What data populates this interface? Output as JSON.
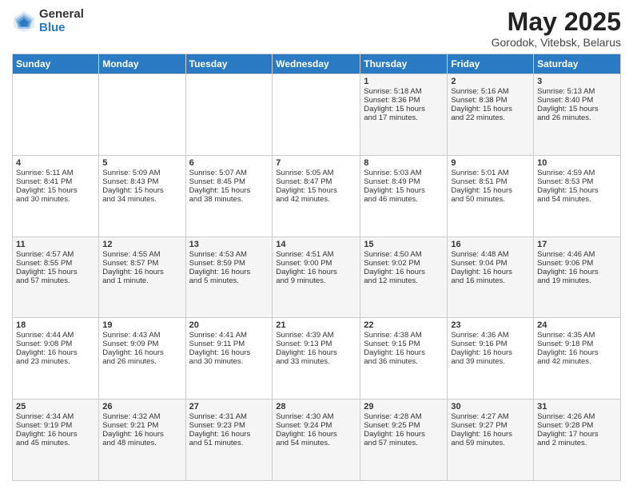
{
  "header": {
    "logo_general": "General",
    "logo_blue": "Blue",
    "month_title": "May 2025",
    "subtitle": "Gorodok, Vitebsk, Belarus"
  },
  "days_of_week": [
    "Sunday",
    "Monday",
    "Tuesday",
    "Wednesday",
    "Thursday",
    "Friday",
    "Saturday"
  ],
  "weeks": [
    [
      {
        "day": "",
        "info": ""
      },
      {
        "day": "",
        "info": ""
      },
      {
        "day": "",
        "info": ""
      },
      {
        "day": "",
        "info": ""
      },
      {
        "day": "1",
        "info": "Sunrise: 5:18 AM\nSunset: 8:36 PM\nDaylight: 15 hours\nand 17 minutes."
      },
      {
        "day": "2",
        "info": "Sunrise: 5:16 AM\nSunset: 8:38 PM\nDaylight: 15 hours\nand 22 minutes."
      },
      {
        "day": "3",
        "info": "Sunrise: 5:13 AM\nSunset: 8:40 PM\nDaylight: 15 hours\nand 26 minutes."
      }
    ],
    [
      {
        "day": "4",
        "info": "Sunrise: 5:11 AM\nSunset: 8:41 PM\nDaylight: 15 hours\nand 30 minutes."
      },
      {
        "day": "5",
        "info": "Sunrise: 5:09 AM\nSunset: 8:43 PM\nDaylight: 15 hours\nand 34 minutes."
      },
      {
        "day": "6",
        "info": "Sunrise: 5:07 AM\nSunset: 8:45 PM\nDaylight: 15 hours\nand 38 minutes."
      },
      {
        "day": "7",
        "info": "Sunrise: 5:05 AM\nSunset: 8:47 PM\nDaylight: 15 hours\nand 42 minutes."
      },
      {
        "day": "8",
        "info": "Sunrise: 5:03 AM\nSunset: 8:49 PM\nDaylight: 15 hours\nand 46 minutes."
      },
      {
        "day": "9",
        "info": "Sunrise: 5:01 AM\nSunset: 8:51 PM\nDaylight: 15 hours\nand 50 minutes."
      },
      {
        "day": "10",
        "info": "Sunrise: 4:59 AM\nSunset: 8:53 PM\nDaylight: 15 hours\nand 54 minutes."
      }
    ],
    [
      {
        "day": "11",
        "info": "Sunrise: 4:57 AM\nSunset: 8:55 PM\nDaylight: 15 hours\nand 57 minutes."
      },
      {
        "day": "12",
        "info": "Sunrise: 4:55 AM\nSunset: 8:57 PM\nDaylight: 16 hours\nand 1 minute."
      },
      {
        "day": "13",
        "info": "Sunrise: 4:53 AM\nSunset: 8:59 PM\nDaylight: 16 hours\nand 5 minutes."
      },
      {
        "day": "14",
        "info": "Sunrise: 4:51 AM\nSunset: 9:00 PM\nDaylight: 16 hours\nand 9 minutes."
      },
      {
        "day": "15",
        "info": "Sunrise: 4:50 AM\nSunset: 9:02 PM\nDaylight: 16 hours\nand 12 minutes."
      },
      {
        "day": "16",
        "info": "Sunrise: 4:48 AM\nSunset: 9:04 PM\nDaylight: 16 hours\nand 16 minutes."
      },
      {
        "day": "17",
        "info": "Sunrise: 4:46 AM\nSunset: 9:06 PM\nDaylight: 16 hours\nand 19 minutes."
      }
    ],
    [
      {
        "day": "18",
        "info": "Sunrise: 4:44 AM\nSunset: 9:08 PM\nDaylight: 16 hours\nand 23 minutes."
      },
      {
        "day": "19",
        "info": "Sunrise: 4:43 AM\nSunset: 9:09 PM\nDaylight: 16 hours\nand 26 minutes."
      },
      {
        "day": "20",
        "info": "Sunrise: 4:41 AM\nSunset: 9:11 PM\nDaylight: 16 hours\nand 30 minutes."
      },
      {
        "day": "21",
        "info": "Sunrise: 4:39 AM\nSunset: 9:13 PM\nDaylight: 16 hours\nand 33 minutes."
      },
      {
        "day": "22",
        "info": "Sunrise: 4:38 AM\nSunset: 9:15 PM\nDaylight: 16 hours\nand 36 minutes."
      },
      {
        "day": "23",
        "info": "Sunrise: 4:36 AM\nSunset: 9:16 PM\nDaylight: 16 hours\nand 39 minutes."
      },
      {
        "day": "24",
        "info": "Sunrise: 4:35 AM\nSunset: 9:18 PM\nDaylight: 16 hours\nand 42 minutes."
      }
    ],
    [
      {
        "day": "25",
        "info": "Sunrise: 4:34 AM\nSunset: 9:19 PM\nDaylight: 16 hours\nand 45 minutes."
      },
      {
        "day": "26",
        "info": "Sunrise: 4:32 AM\nSunset: 9:21 PM\nDaylight: 16 hours\nand 48 minutes."
      },
      {
        "day": "27",
        "info": "Sunrise: 4:31 AM\nSunset: 9:23 PM\nDaylight: 16 hours\nand 51 minutes."
      },
      {
        "day": "28",
        "info": "Sunrise: 4:30 AM\nSunset: 9:24 PM\nDaylight: 16 hours\nand 54 minutes."
      },
      {
        "day": "29",
        "info": "Sunrise: 4:28 AM\nSunset: 9:25 PM\nDaylight: 16 hours\nand 57 minutes."
      },
      {
        "day": "30",
        "info": "Sunrise: 4:27 AM\nSunset: 9:27 PM\nDaylight: 16 hours\nand 59 minutes."
      },
      {
        "day": "31",
        "info": "Sunrise: 4:26 AM\nSunset: 9:28 PM\nDaylight: 17 hours\nand 2 minutes."
      }
    ]
  ]
}
